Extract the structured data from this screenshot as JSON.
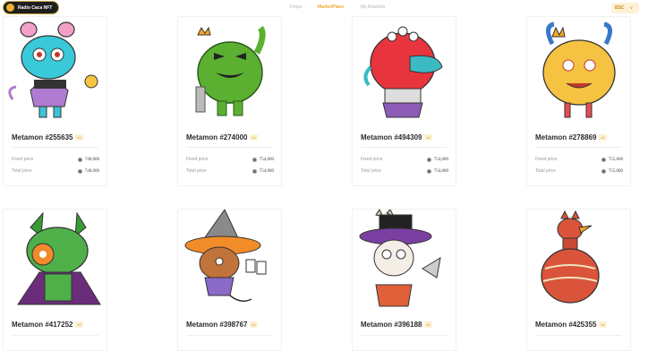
{
  "header": {
    "logo_text": "Radio Caca NFT",
    "nav": [
      "Drops",
      "MarketPlace",
      "My Artworks"
    ],
    "network": "BSC",
    "network_caret": "∨"
  },
  "labels": {
    "fixed": "Fixed price",
    "total": "Total price"
  },
  "cards": [
    {
      "name": "Metamon #255635",
      "badge": "x1",
      "fixed": "748,000",
      "total": "748,000"
    },
    {
      "name": "Metamon #274000",
      "badge": "x1",
      "fixed": "754,000",
      "total": "754,000"
    },
    {
      "name": "Metamon #494309",
      "badge": "x1",
      "fixed": "754,000",
      "total": "754,000"
    },
    {
      "name": "Metamon #278869",
      "badge": "x1",
      "fixed": "755,000",
      "total": "755,000"
    },
    {
      "name": "Metamon #417252",
      "badge": "x1"
    },
    {
      "name": "Metamon #398767",
      "badge": "x1"
    },
    {
      "name": "Metamon #396188",
      "badge": "x1"
    },
    {
      "name": "Metamon #425355",
      "badge": "x1"
    }
  ]
}
